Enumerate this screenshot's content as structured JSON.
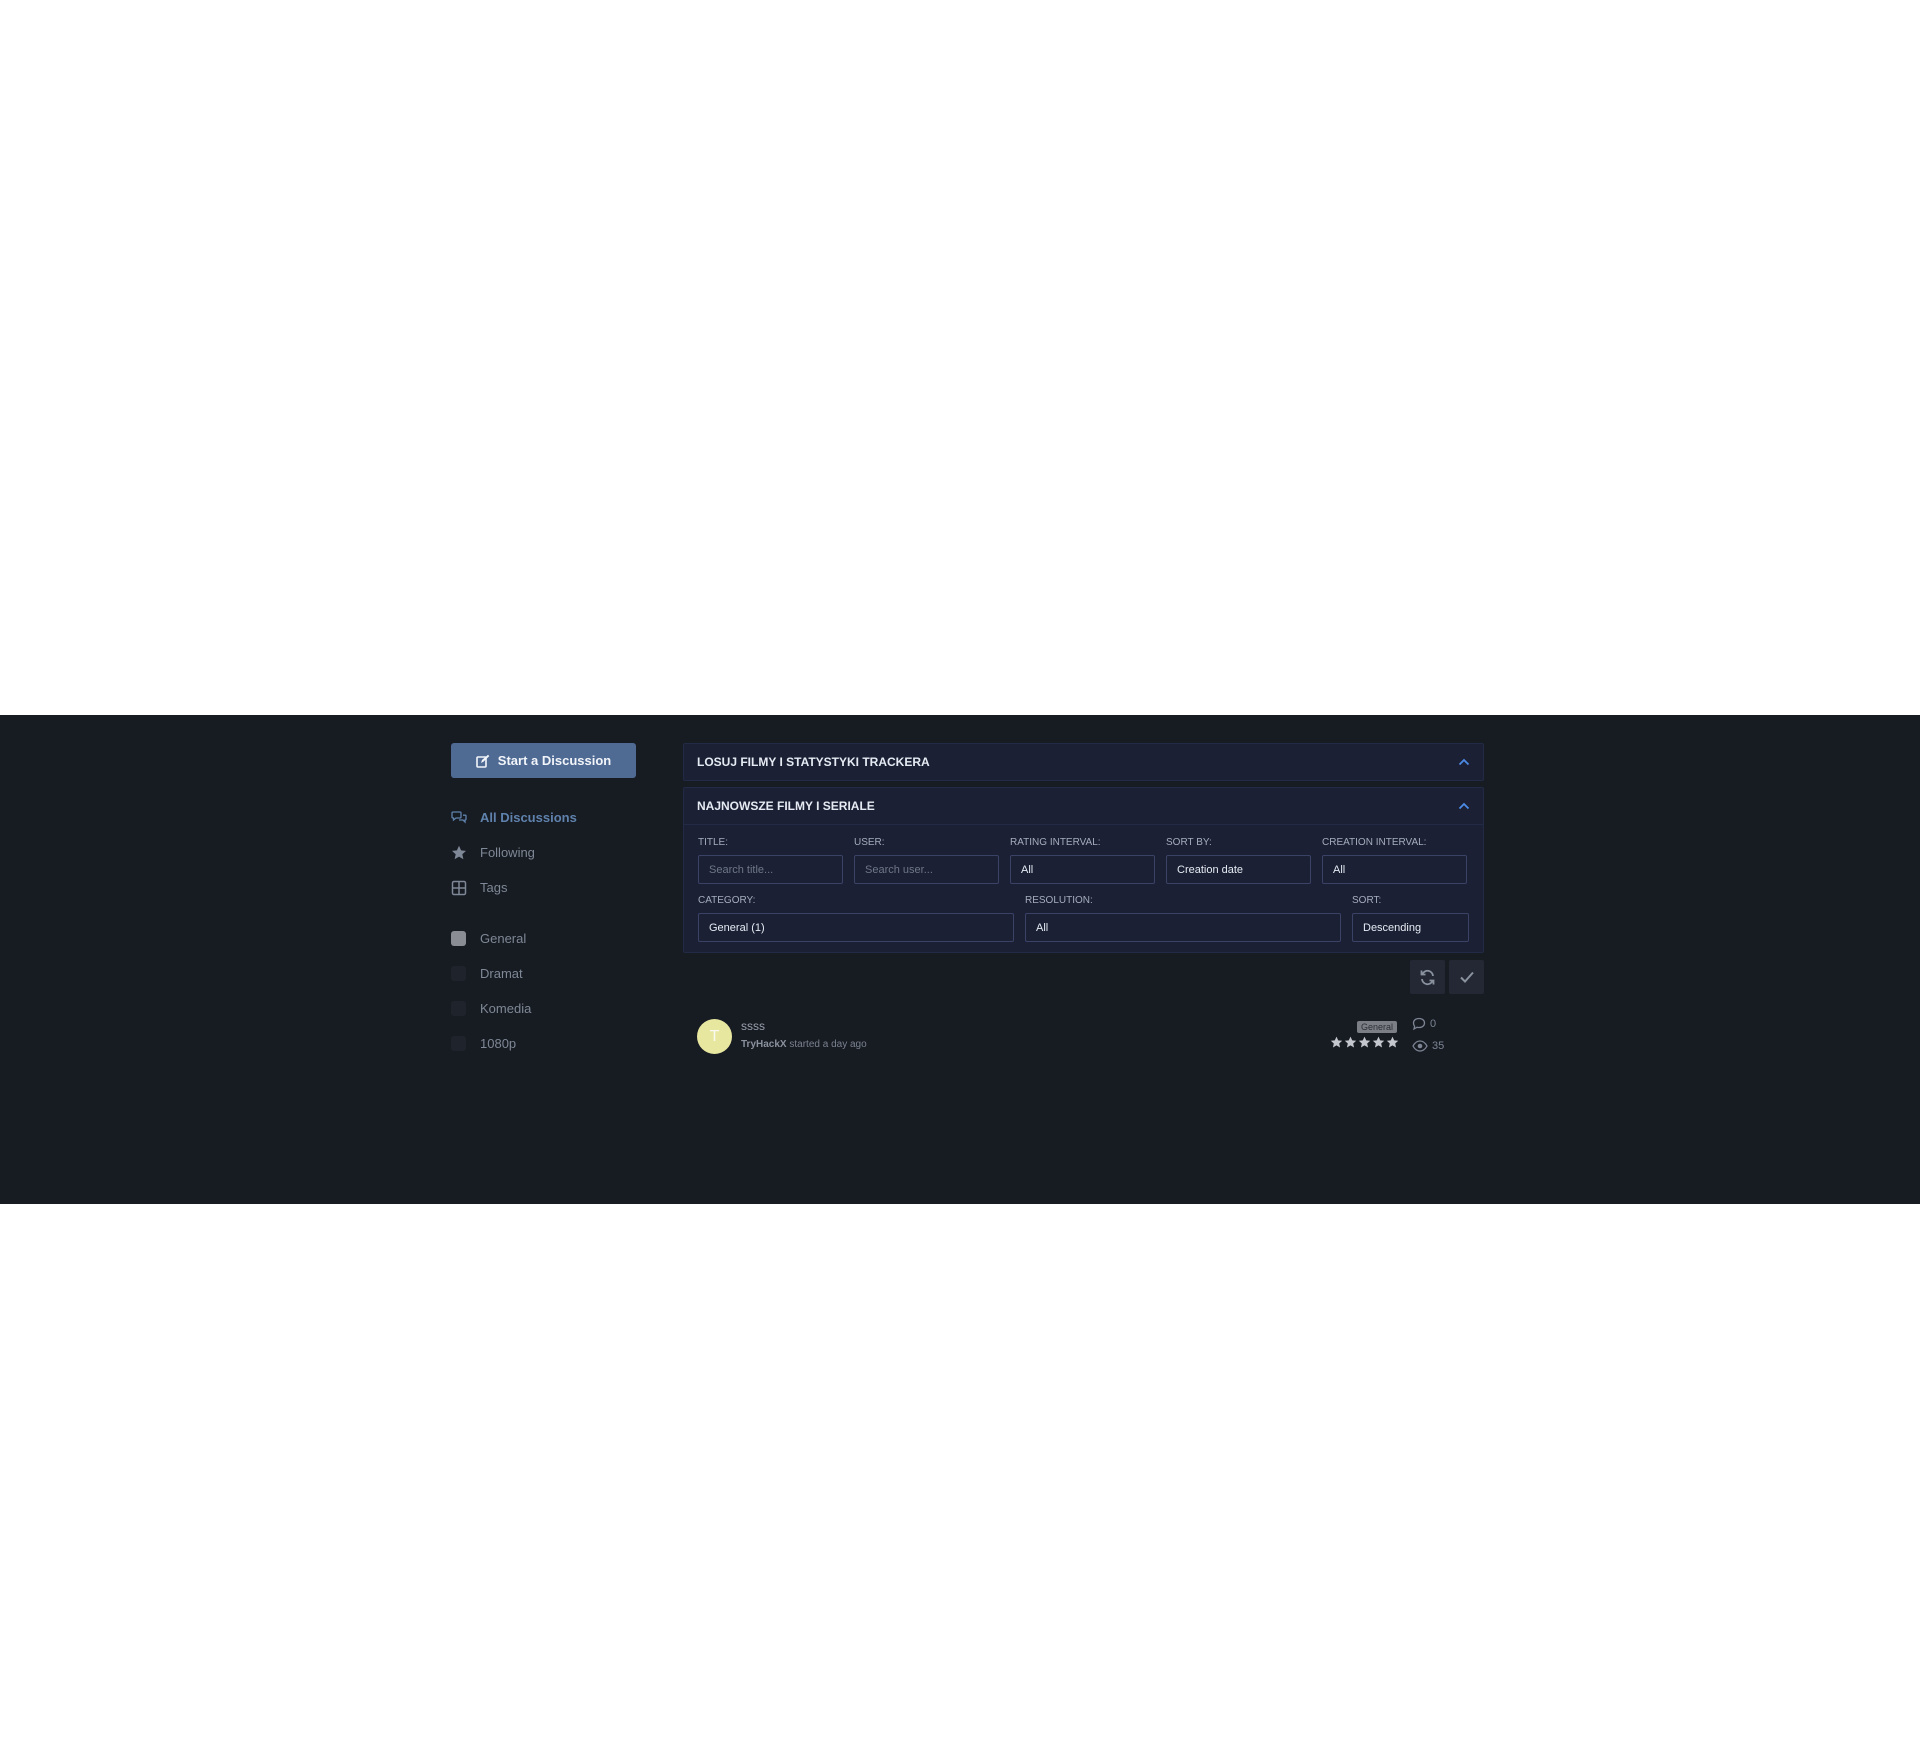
{
  "sidebar": {
    "start_label": "Start a Discussion",
    "nav": [
      {
        "label": "All Discussions",
        "icon": "discussions-icon"
      },
      {
        "label": "Following",
        "icon": "star-icon"
      },
      {
        "label": "Tags",
        "icon": "tags-grid-icon"
      }
    ],
    "tags": [
      {
        "label": "General",
        "color": "#8a8d93"
      },
      {
        "label": "Dramat",
        "color": "#1f232b"
      },
      {
        "label": "Komedia",
        "color": "#1f232b"
      },
      {
        "label": "1080p",
        "color": "#1f232b"
      }
    ]
  },
  "panels": {
    "random_title": "LOSUJ FILMY I STATYSTYKI TRACKERA",
    "latest_title": "NAJNOWSZE FILMY I SERIALE"
  },
  "filters": {
    "title_label": "TITLE:",
    "title_placeholder": "Search title...",
    "user_label": "USER:",
    "user_placeholder": "Search user...",
    "rating_label": "RATING INTERVAL:",
    "rating_value": "All",
    "sortby_label": "SORT BY:",
    "sortby_value": "Creation date",
    "creation_label": "CREATION INTERVAL:",
    "creation_value": "All",
    "category_label": "CATEGORY:",
    "category_value": "General (1)",
    "resolution_label": "RESOLUTION:",
    "resolution_value": "All",
    "sort_label": "SORT:",
    "sort_value": "Descending"
  },
  "discussion": {
    "avatar_letter": "T",
    "avatar_color": "#e8e7a0",
    "title": "ssss",
    "author": "TryHackX",
    "started": "started a day ago",
    "tag": "General",
    "rating_stars": 5,
    "comments": "0",
    "views": "35"
  },
  "colors": {
    "accent": "#4f6a93",
    "background": "#171b22",
    "panel": "#1b2034"
  }
}
